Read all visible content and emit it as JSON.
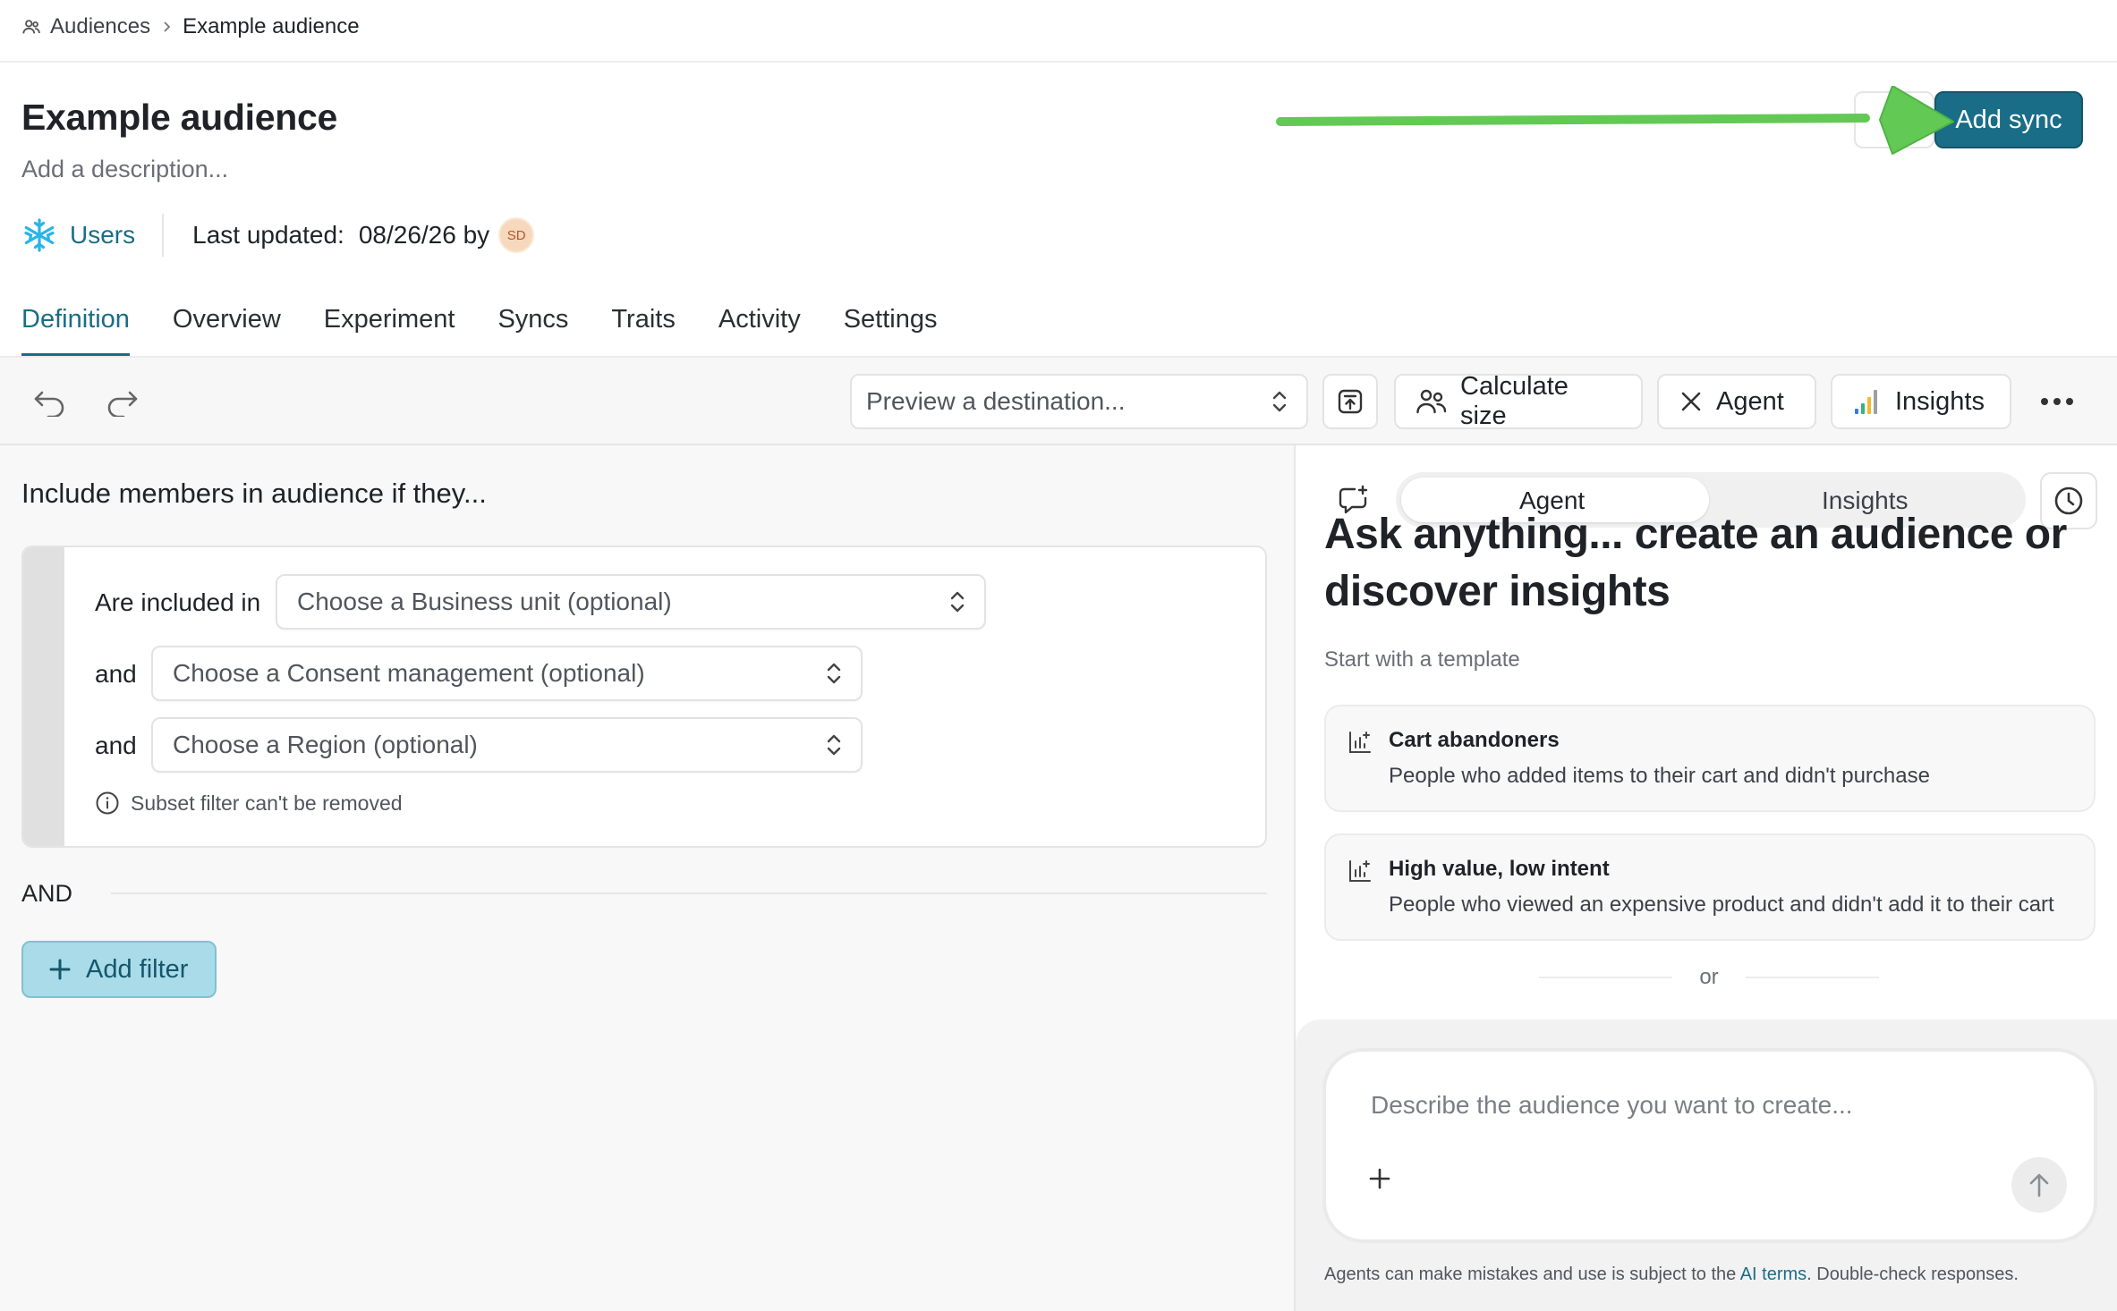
{
  "breadcrumb": {
    "parent": "Audiences",
    "current": "Example audience"
  },
  "header": {
    "title": "Example audience",
    "description": "Add a description...",
    "source": "Users",
    "last_updated_label": "Last updated:",
    "last_updated_value": "08/26/26 by",
    "avatar_initials": "SD",
    "add_sync_label": "Add sync",
    "annotation_arrow_color": "#63c955"
  },
  "tabs": [
    {
      "label": "Definition",
      "active": true
    },
    {
      "label": "Overview"
    },
    {
      "label": "Experiment"
    },
    {
      "label": "Syncs"
    },
    {
      "label": "Traits"
    },
    {
      "label": "Activity"
    },
    {
      "label": "Settings"
    }
  ],
  "toolbar": {
    "preview_placeholder": "Preview a destination...",
    "calculate_size": "Calculate size",
    "agent": "Agent",
    "insights": "Insights"
  },
  "definition": {
    "heading": "Include members in audience if they...",
    "conditions": [
      {
        "label": "Are included in",
        "value": "Choose a Business unit (optional)"
      },
      {
        "label": "and",
        "value": "Choose a Consent management (optional)"
      },
      {
        "label": "and",
        "value": "Choose a Region (optional)"
      }
    ],
    "subset_note": "Subset filter can't be removed",
    "and_label": "AND",
    "add_filter": "Add filter"
  },
  "agent_panel": {
    "tabs": [
      "Agent",
      "Insights"
    ],
    "active_tab": "Agent",
    "headline": "Ask anything... create an audience or discover insights",
    "start_label": "Start with a template",
    "templates": [
      {
        "title": "Cart abandoners",
        "description": "People who added items to their cart and didn't purchase"
      },
      {
        "title": "High value, low intent",
        "description": "People who viewed an expensive product and didn't add it to their cart"
      }
    ],
    "or_label": "or",
    "composer_placeholder": "Describe the audience you want to create...",
    "disclaimer_prefix": "Agents can make mistakes and use is subject to the ",
    "disclaimer_link": "AI terms",
    "disclaimer_suffix": ". Double-check responses."
  },
  "colors": {
    "brand": "#1a6d87",
    "add_filter_bg": "#a9dbe8",
    "snowflake": "#29b5e8"
  },
  "icons": [
    "users-icon",
    "chevron-right-icon",
    "snowflake-icon",
    "undo-icon",
    "redo-icon",
    "chevron-updown-icon",
    "export-icon",
    "people-icon",
    "close-icon",
    "bar-chart-icon",
    "more-icon",
    "info-icon",
    "plus-icon",
    "chat-sparkle-icon",
    "clock-icon",
    "template-chart-icon",
    "arrow-up-icon"
  ]
}
